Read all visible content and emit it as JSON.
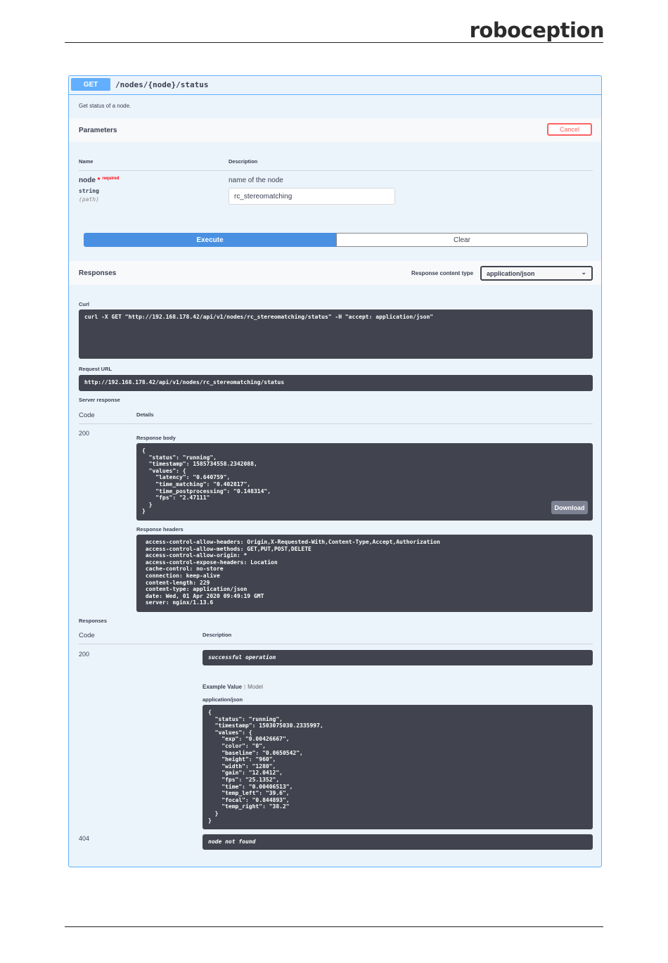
{
  "brand": "roboception",
  "operation": {
    "method": "GET",
    "path": "/nodes/{node}/status",
    "description": "Get status of a node."
  },
  "parameters": {
    "title": "Parameters",
    "cancel_label": "Cancel",
    "col_name": "Name",
    "col_description": "Description",
    "param": {
      "name": "node",
      "required_star": "*",
      "required_label": "required",
      "type": "string",
      "location": "(path)",
      "description": "name of the node",
      "value": "rc_stereomatching"
    },
    "execute_label": "Execute",
    "clear_label": "Clear"
  },
  "responses_header": {
    "title": "Responses",
    "content_type_label": "Response content type",
    "content_type_value": "application/json"
  },
  "live": {
    "curl_label": "Curl",
    "curl": "curl -X GET \"http://192.168.178.42/api/v1/nodes/rc_stereomatching/status\" -H \"accept: application/json\"",
    "request_url_label": "Request URL",
    "request_url": "http://192.168.178.42/api/v1/nodes/rc_stereomatching/status",
    "server_response_label": "Server response",
    "col_code": "Code",
    "col_details": "Details",
    "code": "200",
    "response_body_label": "Response body",
    "response_body": "{\n  \"status\": \"running\",\n  \"timestamp\": 1585734558.2342088,\n  \"values\": {\n    \"latency\": \"0.640759\",\n    \"time_matching\": \"0.402817\",\n    \"time_postprocessing\": \"0.148314\",\n    \"fps\": \"2.47111\"\n  }\n}",
    "download_label": "Download",
    "response_headers_label": "Response headers",
    "response_headers": " access-control-allow-headers: Origin,X-Requested-With,Content-Type,Accept,Authorization\n access-control-allow-methods: GET,PUT,POST,DELETE\n access-control-allow-origin: *\n access-control-expose-headers: Location\n cache-control: no-store\n connection: keep-alive\n content-length: 229\n content-type: application/json\n date: Wed, 01 Apr 2020 09:49:19 GMT\n server: nginx/1.13.6"
  },
  "documented": {
    "title": "Responses",
    "col_code": "Code",
    "col_description": "Description",
    "r200_code": "200",
    "r200_desc": "successful operation",
    "example_value_label": "Example Value",
    "model_label": "Model",
    "media_type": "application/json",
    "example": "{\n  \"status\": \"running\",\n  \"timestamp\": 1503075030.2335997,\n  \"values\": {\n    \"exp\": \"0.00426667\",\n    \"color\": \"0\",\n    \"baseline\": \"0.0650542\",\n    \"height\": \"960\",\n    \"width\": \"1280\",\n    \"gain\": \"12.0412\",\n    \"fps\": \"25.1352\",\n    \"time\": \"0.00406513\",\n    \"temp_left\": \"39.6\",\n    \"focal\": \"0.844893\",\n    \"temp_right\": \"38.2\"\n  }\n}",
    "r404_code": "404",
    "r404_desc": "node not found"
  }
}
